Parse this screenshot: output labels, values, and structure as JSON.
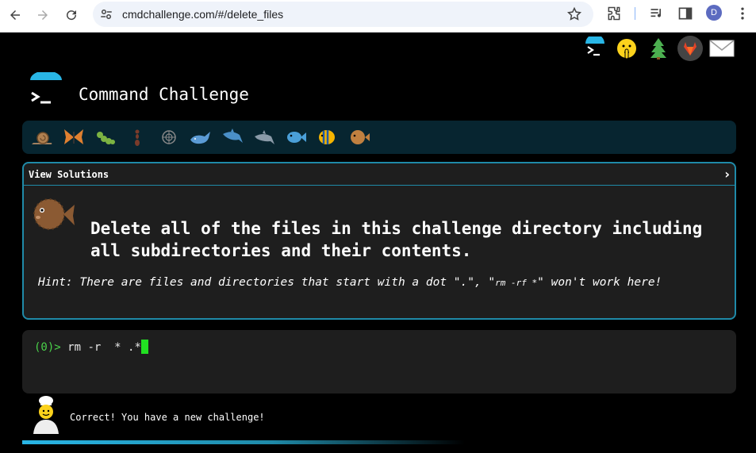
{
  "browser": {
    "url": "cmdchallenge.com/#/delete_files",
    "profile_initial": "D"
  },
  "header": {
    "title": "Command Challenge",
    "top_icons": [
      "terminal-icon",
      "shushing-face-icon",
      "tree-icon",
      "gitlab-icon",
      "envelope-icon"
    ]
  },
  "levels": [
    "snail-icon",
    "butterfly-icon",
    "bug-icon",
    "ant-icon",
    "shell-icon",
    "whale-icon",
    "dolphin-icon",
    "dolphin-icon",
    "fish-icon",
    "tropical-fish-icon",
    "blowfish-icon"
  ],
  "challenge": {
    "view_solutions": "View Solutions",
    "chevron": "›",
    "description": "Delete all of the files in this challenge directory including all subdirectories and their contents.",
    "hint_prefix": "Hint: There are files and directories that start with a dot \".\", \"",
    "hint_code": "rm -rf *",
    "hint_suffix": "\" won't work here!"
  },
  "terminal": {
    "prompt": "(0)>",
    "command": "rm -r  * .*"
  },
  "status": {
    "message": "Correct! You have a new challenge!"
  },
  "colors": {
    "accent": "#1f8aa8",
    "prompt_green": "#4ad24a",
    "level_bar": "#072530"
  }
}
